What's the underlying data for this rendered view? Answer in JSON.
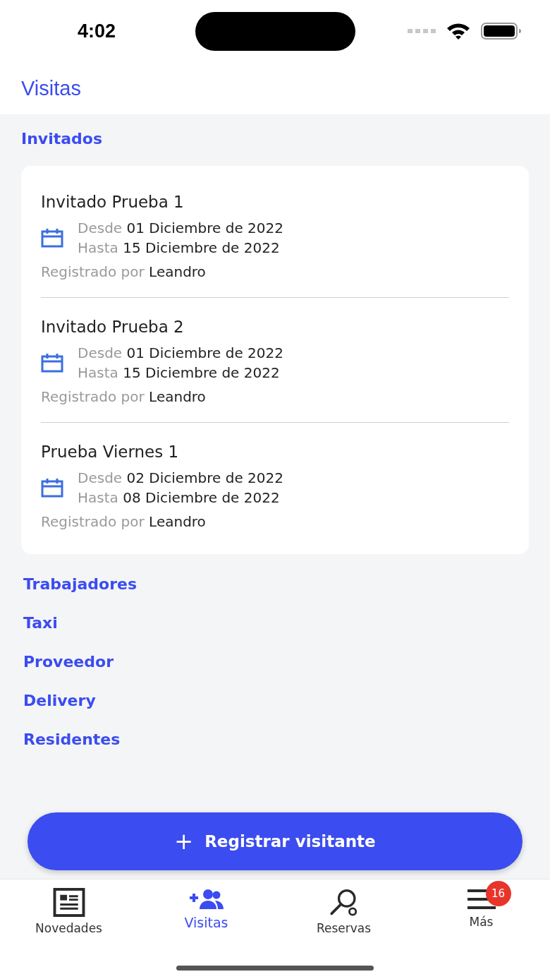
{
  "status_bar": {
    "time": "4:02"
  },
  "header": {
    "title": "Visitas"
  },
  "sections": [
    {
      "title": "Invitados",
      "visitors": [
        {
          "name": "Invitado Prueba 1",
          "from_label": "Desde",
          "from": "01 Diciembre de 2022",
          "to_label": "Hasta",
          "to": "15 Diciembre de 2022",
          "registered_label": "Registrado por",
          "registered_by": "Leandro"
        },
        {
          "name": "Invitado Prueba 2",
          "from_label": "Desde",
          "from": "01 Diciembre de 2022",
          "to_label": "Hasta",
          "to": "15 Diciembre de 2022",
          "registered_label": "Registrado por",
          "registered_by": "Leandro"
        },
        {
          "name": "Prueba Viernes 1",
          "from_label": "Desde",
          "from": "02 Diciembre de 2022",
          "to_label": "Hasta",
          "to": "08 Diciembre de 2022",
          "registered_label": "Registrado por",
          "registered_by": "Leandro"
        }
      ]
    },
    {
      "title": "Trabajadores"
    },
    {
      "title": "Taxi"
    },
    {
      "title": "Proveedor"
    },
    {
      "title": "Delivery"
    },
    {
      "title": "Residentes"
    }
  ],
  "action_button": {
    "icon": "+",
    "label": "Registrar visitante"
  },
  "tab_bar": [
    {
      "kind": "news",
      "label": "Novedades",
      "selected": false
    },
    {
      "kind": "visits",
      "label": "Visitas",
      "selected": true
    },
    {
      "kind": "bookings",
      "label": "Reservas",
      "selected": false
    },
    {
      "kind": "more",
      "label": "Más",
      "selected": false,
      "badge": "16"
    }
  ]
}
